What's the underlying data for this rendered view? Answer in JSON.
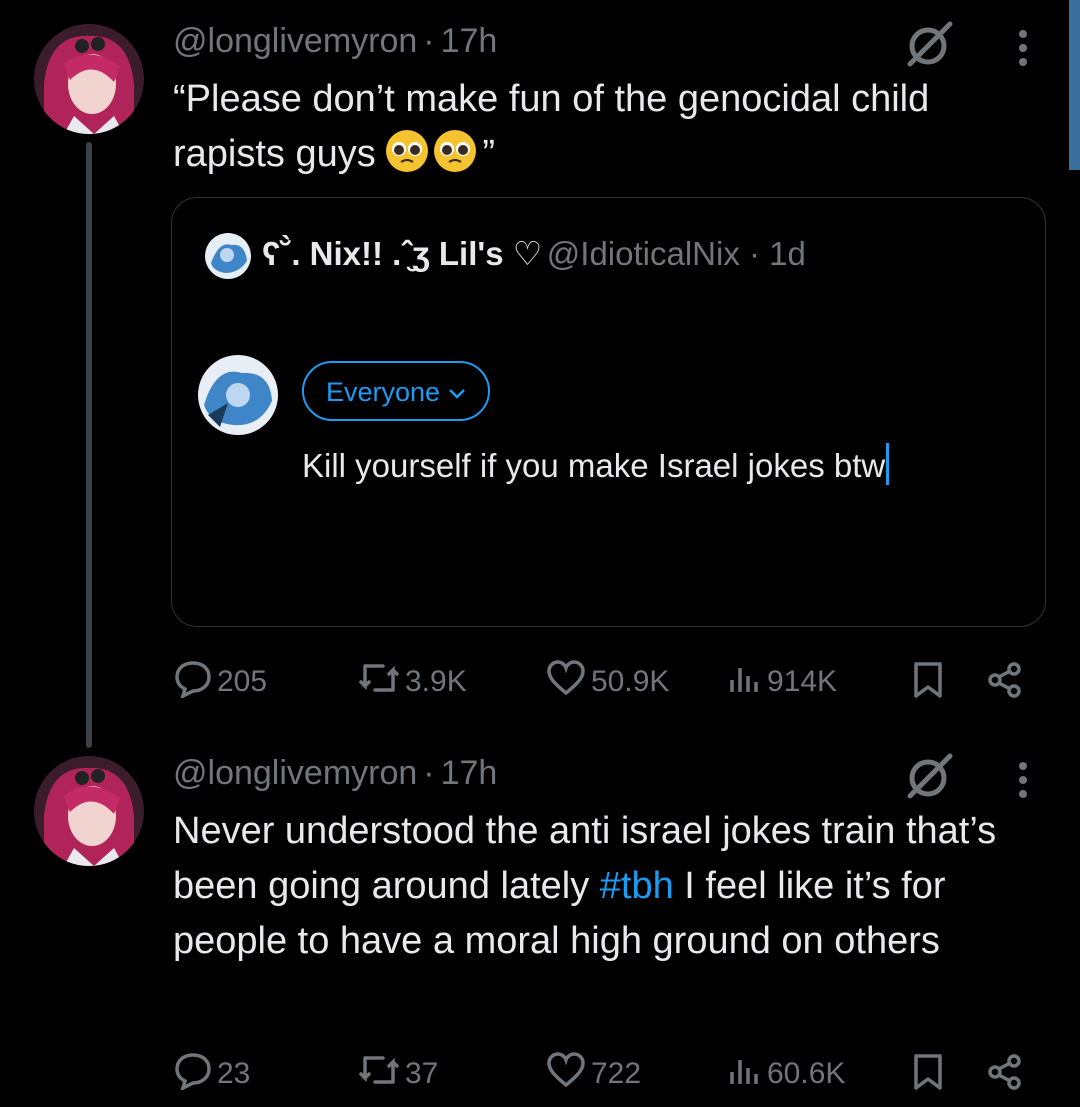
{
  "post1": {
    "handle": "@longlivemyron",
    "time": "17h",
    "text_before": "“Please don’t make fun of the genocidal child rapists guys",
    "text_after": "”",
    "emoji": "pleading-face",
    "quote": {
      "name": "ʕ˘̀. Nix!! .ˆ̮ʒ Lil's ♡",
      "handle": "@IdioticalNix",
      "time": "1d",
      "audience_label": "Everyone",
      "compose_text": "Kill yourself if you make Israel jokes btw"
    },
    "stats": {
      "replies": "205",
      "reposts": "3.9K",
      "likes": "50.9K",
      "views": "914K"
    }
  },
  "post2": {
    "handle": "@longlivemyron",
    "time": "17h",
    "text_before": "Never understood the anti israel jokes train that’s been going around lately ",
    "hashtag": "#tbh",
    "text_after": " I feel like it’s for people to have a moral high ground on others",
    "stats": {
      "replies": "23",
      "reposts": "37",
      "likes": "722",
      "views": "60.6K"
    }
  },
  "colors": {
    "accent": "#1d9bf0",
    "muted": "#71767b",
    "text": "#e7e9ea",
    "background": "#000000"
  }
}
